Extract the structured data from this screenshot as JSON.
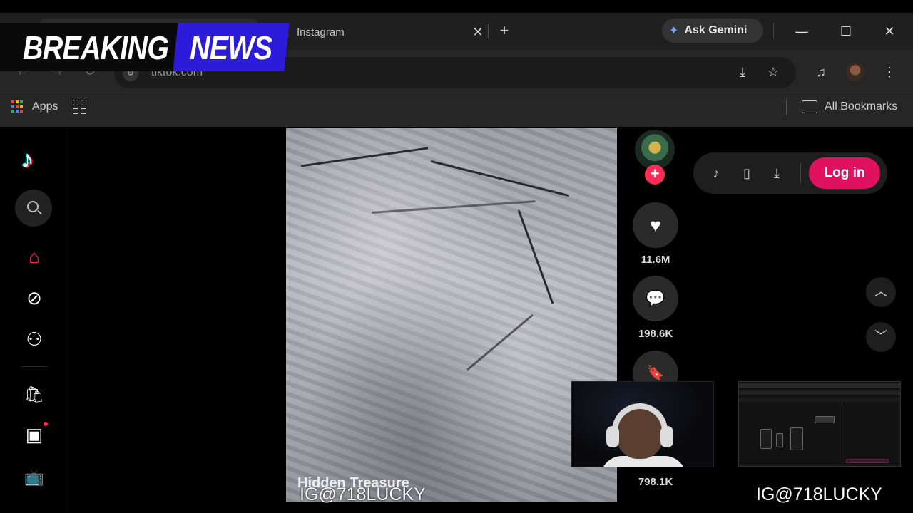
{
  "banner": {
    "breaking": "BREAKING",
    "news": "NEWS"
  },
  "browser": {
    "tab": {
      "title": "Instagram",
      "close": "✕"
    },
    "new_tab": "+",
    "gemini": {
      "label": "Ask Gemini",
      "icon": "sparkle-icon"
    },
    "window": {
      "minimize": "—",
      "maximize": "☐",
      "close": "✕"
    },
    "url": "tiktok.com",
    "site_icon": "⚙",
    "toolbar_icons": {
      "install": "⤓",
      "bookmark": "☆",
      "media": "♫",
      "menu": "⋮"
    },
    "nav": {
      "back": "←",
      "forward": "→",
      "reload": "↻"
    }
  },
  "bookmarks": {
    "apps_label": "Apps",
    "all_bookmarks": "All Bookmarks",
    "apps_colors": [
      "#ea4335",
      "#fbbc05",
      "#34a853",
      "#4285f4",
      "#ea4335",
      "#fbbc05",
      "#34a853",
      "#4285f4",
      "#ea4335"
    ]
  },
  "tiktok": {
    "logo": "♪",
    "rail_icons": {
      "home": "⌂",
      "explore": "⊘",
      "following": "⚇",
      "shop": "🛍",
      "live": "▣",
      "tv": "📺"
    },
    "video_caption": "Hidden Treasure",
    "follow": "+",
    "likes": "11.6M",
    "comments": "198.6K",
    "saves": "798.1K",
    "action_icons": {
      "like": "♥",
      "comment": "💬",
      "save": "🔖"
    },
    "pill_icons": {
      "tiktok": "♪",
      "device": "▯",
      "download": "⤓"
    },
    "login": "Log in",
    "arrows": {
      "up": "︿",
      "down": "﹀"
    },
    "accent": "#fe2c55"
  },
  "overlay": {
    "ig_left": "IG@718LUCKY",
    "ig_right": "IG@718LUCKY"
  }
}
